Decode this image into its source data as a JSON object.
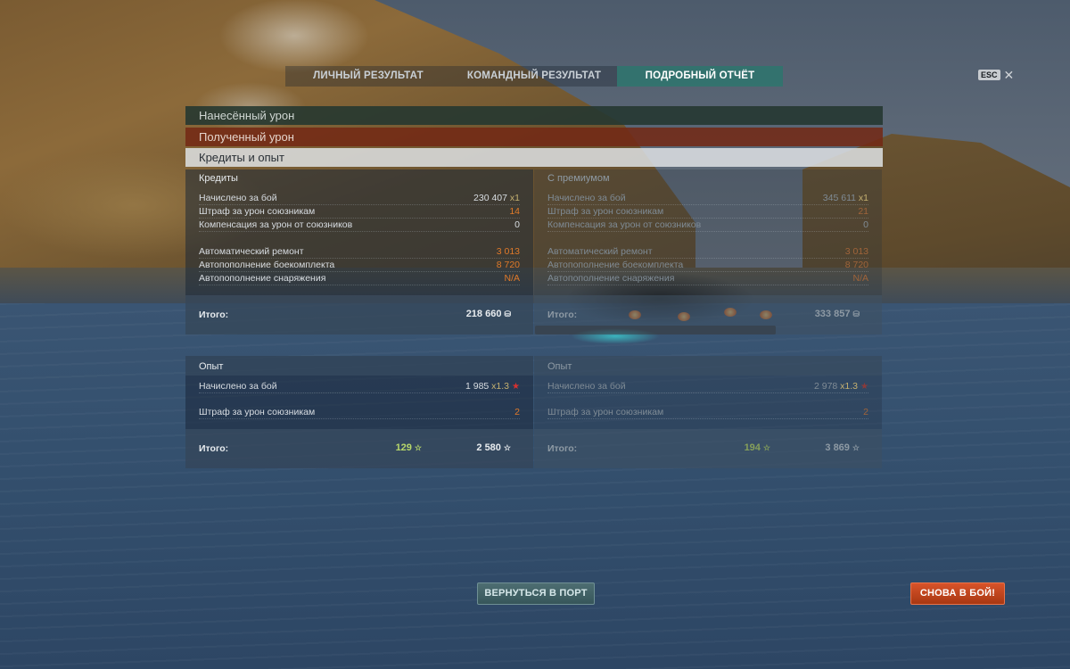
{
  "tabs": [
    {
      "label": "ЛИЧНЫЙ РЕЗУЛЬТАТ"
    },
    {
      "label": "КОМАНДНЫЙ РЕЗУЛЬТАТ"
    },
    {
      "label": "ПОДРОБНЫЙ ОТЧЁТ",
      "active": true
    }
  ],
  "esc": {
    "key": "ESC",
    "close": "✕"
  },
  "sections": {
    "damage_dealt": "Нанесённый урон",
    "damage_received": "Полученный урон",
    "credits_exp": "Кредиты и опыт"
  },
  "credits": {
    "base": {
      "header": "Кредиты",
      "earned_label": "Начислено за бой",
      "earned_value": "230 407",
      "earned_mult": "x1",
      "penalty_label": "Штраф за урон союзникам",
      "penalty_value": "14",
      "comp_label": "Компенсация за урон от союзников",
      "comp_value": "0",
      "repair_label": "Автоматический ремонт",
      "repair_value": "3 013",
      "ammo_label": "Автопополнение боекомплекта",
      "ammo_value": "8 720",
      "equip_label": "Автопополнение снаряжения",
      "equip_value": "N/A",
      "total_label": "Итого:",
      "total_value": "218 660"
    },
    "premium": {
      "header": "С премиумом",
      "earned_label": "Начислено за бой",
      "earned_value": "345 611",
      "earned_mult": "x1",
      "penalty_label": "Штраф за урон союзникам",
      "penalty_value": "21",
      "comp_label": "Компенсация за урон от союзников",
      "comp_value": "0",
      "repair_label": "Автоматический ремонт",
      "repair_value": "3 013",
      "ammo_label": "Автопополнение боекомплекта",
      "ammo_value": "8 720",
      "equip_label": "Автопополнение снаряжения",
      "equip_value": "N/A",
      "total_label": "Итого:",
      "total_value": "333 857"
    }
  },
  "experience": {
    "base": {
      "header": "Опыт",
      "earned_label": "Начислено за бой",
      "earned_value": "1 985",
      "earned_mult": "x1.3",
      "penalty_label": "Штраф за урон союзникам",
      "penalty_value": "2",
      "total_label": "Итого:",
      "total_free": "129",
      "total_value": "2 580"
    },
    "premium": {
      "header": "Опыт",
      "earned_label": "Начислено за бой",
      "earned_value": "2 978",
      "earned_mult": "x1.3",
      "penalty_label": "Штраф за урон союзникам",
      "penalty_value": "2",
      "total_label": "Итого:",
      "total_free": "194",
      "total_value": "3 869"
    }
  },
  "buttons": {
    "port": "ВЕРНУТЬСЯ В ПОРТ",
    "battle": "СНОВА В БОЙ!"
  },
  "icons": {
    "credit": "credits-icon",
    "star": "star-icon",
    "red_star": "red-star-icon",
    "close": "close-icon"
  },
  "colors": {
    "active_tab": "#287870",
    "damage_received_bar": "#732814",
    "penalty_orange": "#e07a2a",
    "free_exp_green": "#b8d86a",
    "battle_button": "#c8481e"
  }
}
